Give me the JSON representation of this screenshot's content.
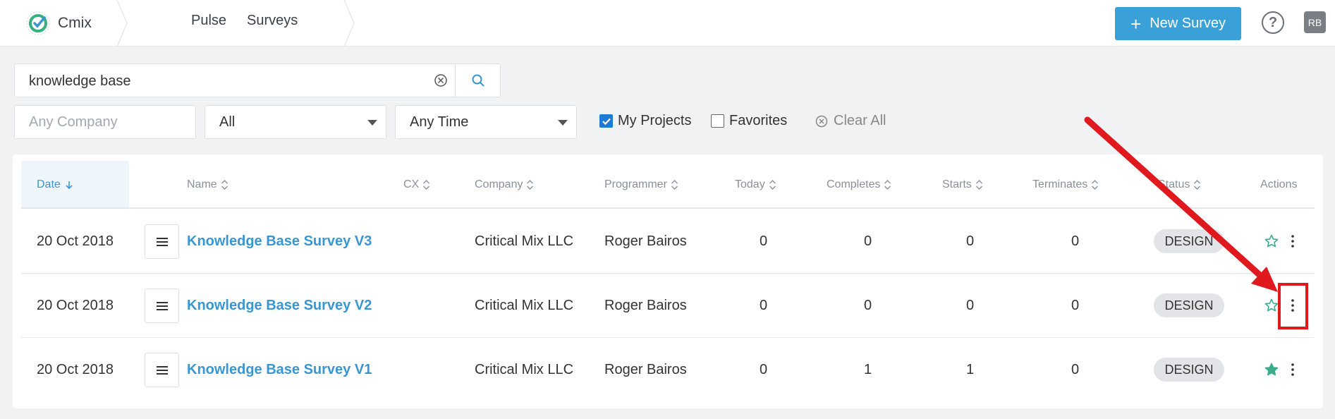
{
  "app": {
    "brand": "Cmix",
    "nav": [
      "Pulse",
      "Surveys"
    ]
  },
  "header": {
    "new_survey_label": "New Survey",
    "help_symbol": "?",
    "avatar_initials": "RB"
  },
  "search": {
    "value": "knowledge base",
    "placeholder": ""
  },
  "filters": {
    "company_placeholder": "Any Company",
    "type_value": "All",
    "time_value": "Any Time",
    "my_projects_label": "My Projects",
    "my_projects_checked": true,
    "favorites_label": "Favorites",
    "favorites_checked": false,
    "clear_all_label": "Clear All"
  },
  "table": {
    "columns": [
      "Date",
      "Name",
      "CX",
      "Company",
      "Programmer",
      "Today",
      "Completes",
      "Starts",
      "Terminates",
      "Status",
      "Actions"
    ],
    "sorted_column": "Date",
    "rows": [
      {
        "date": "20 Oct 2018",
        "name": "Knowledge Base Survey V3",
        "cx": "",
        "company": "Critical Mix LLC",
        "programmer": "Roger Bairos",
        "today": "0",
        "completes": "0",
        "starts": "0",
        "terminates": "0",
        "status": "DESIGN",
        "favorite": false
      },
      {
        "date": "20 Oct 2018",
        "name": "Knowledge Base Survey V2",
        "cx": "",
        "company": "Critical Mix LLC",
        "programmer": "Roger Bairos",
        "today": "0",
        "completes": "0",
        "starts": "0",
        "terminates": "0",
        "status": "DESIGN",
        "favorite": false
      },
      {
        "date": "20 Oct 2018",
        "name": "Knowledge Base Survey V1",
        "cx": "",
        "company": "Critical Mix LLC",
        "programmer": "Roger Bairos",
        "today": "0",
        "completes": "1",
        "starts": "1",
        "terminates": "0",
        "status": "DESIGN",
        "favorite": true
      }
    ]
  },
  "colors": {
    "accent": "#3aa0d8",
    "link": "#3a96d1",
    "favorite": "#3aae8a",
    "annotation": "#e0191e"
  }
}
